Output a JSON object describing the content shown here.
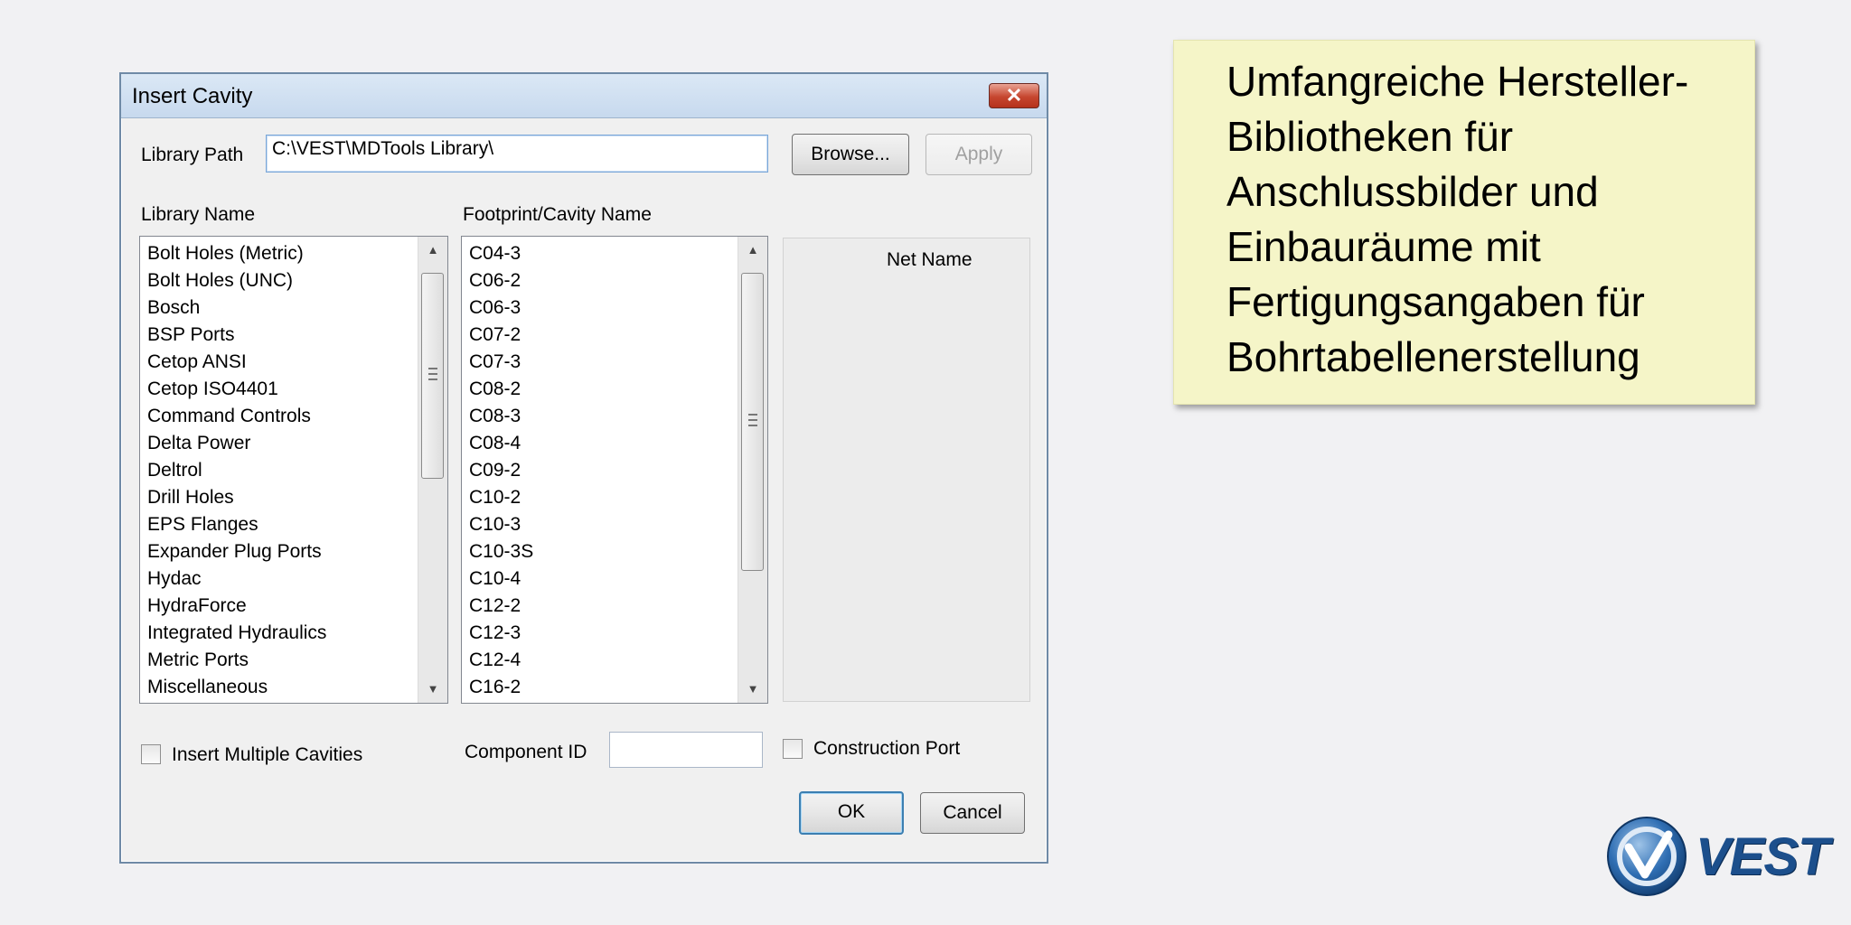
{
  "dialog": {
    "title": "Insert Cavity",
    "close_glyph": "✕",
    "library_path_label": "Library Path",
    "library_path_value": "C:\\VEST\\MDTools Library\\",
    "browse_label": "Browse...",
    "apply_label": "Apply",
    "library_name_header": "Library Name",
    "footprint_header": "Footprint/Cavity Name",
    "library_names": [
      "Bolt Holes (Metric)",
      "Bolt Holes (UNC)",
      "Bosch",
      "BSP Ports",
      "Cetop ANSI",
      "Cetop ISO4401",
      "Command Controls",
      "Delta Power",
      "Deltrol",
      "Drill Holes",
      "EPS Flanges",
      "Expander Plug Ports",
      "Hydac",
      "HydraForce",
      "Integrated Hydraulics",
      "Metric Ports",
      "Miscellaneous"
    ],
    "footprints": [
      "C04-3",
      "C06-2",
      "C06-3",
      "C07-2",
      "C07-3",
      "C08-2",
      "C08-3",
      "C08-4",
      "C09-2",
      "C10-2",
      "C10-3",
      "C10-3S",
      "C10-4",
      "C12-2",
      "C12-3",
      "C12-4",
      "C16-2"
    ],
    "net_name_header": "Net Name",
    "insert_multiple_label": "Insert Multiple Cavities",
    "insert_multiple_checked": false,
    "component_id_label": "Component ID",
    "component_id_value": "",
    "construction_port_label": "Construction Port",
    "construction_port_checked": false,
    "ok_label": "OK",
    "cancel_label": "Cancel"
  },
  "callout": {
    "lines": [
      "Umfangreiche Hersteller-",
      "Bibliotheken für",
      "Anschlussbilder und",
      "Einbauräume mit",
      "Fertigungsangaben für",
      "Bohrtabellenerstellung"
    ]
  },
  "logo": {
    "text": "VEST",
    "brand_color": "#1c4f8c"
  },
  "colors": {
    "background": "#f1f1f3",
    "callout_background": "#f5f5c8",
    "close_button": "#c6462f"
  }
}
